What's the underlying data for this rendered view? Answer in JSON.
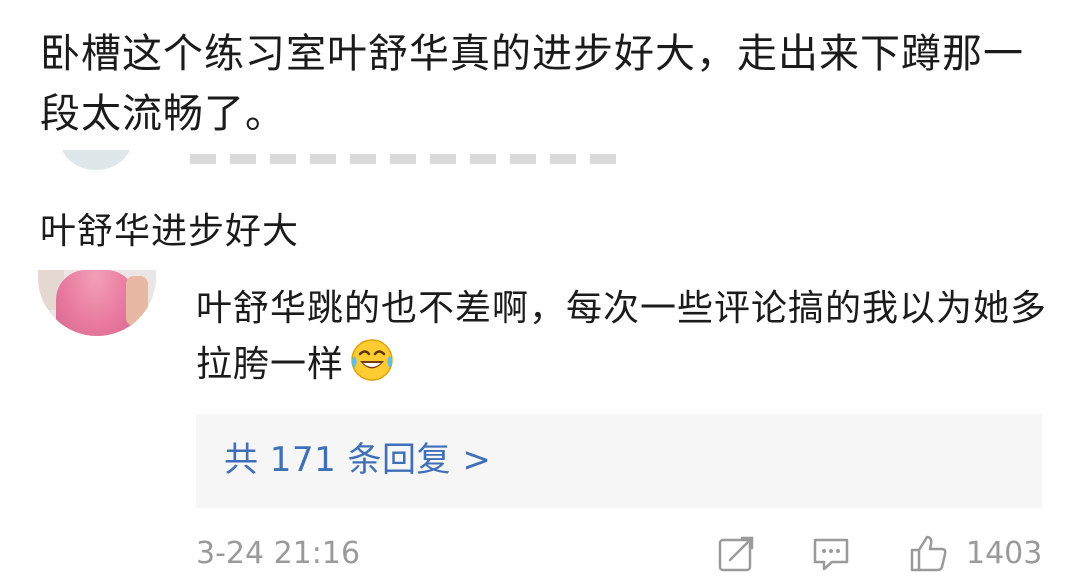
{
  "comment_top": {
    "text": "卧槽这个练习室叶舒华真的进步好大，走出来下蹲那一段太流畅了。"
  },
  "quote": {
    "text": "叶舒华进步好大"
  },
  "reply": {
    "text": "叶舒华跳的也不差啊，每次一些评论搞的我以为她多拉胯一样",
    "emoji": "laughing-tears-emoji"
  },
  "replies_box": {
    "label": "共 171 条回复 >"
  },
  "meta": {
    "timestamp": "3-24 21:16",
    "like_count": "1403"
  },
  "colors": {
    "link": "#3f6fb6",
    "meta_gray": "#9a9a9a",
    "reply_box_bg": "#f6f6f6"
  }
}
